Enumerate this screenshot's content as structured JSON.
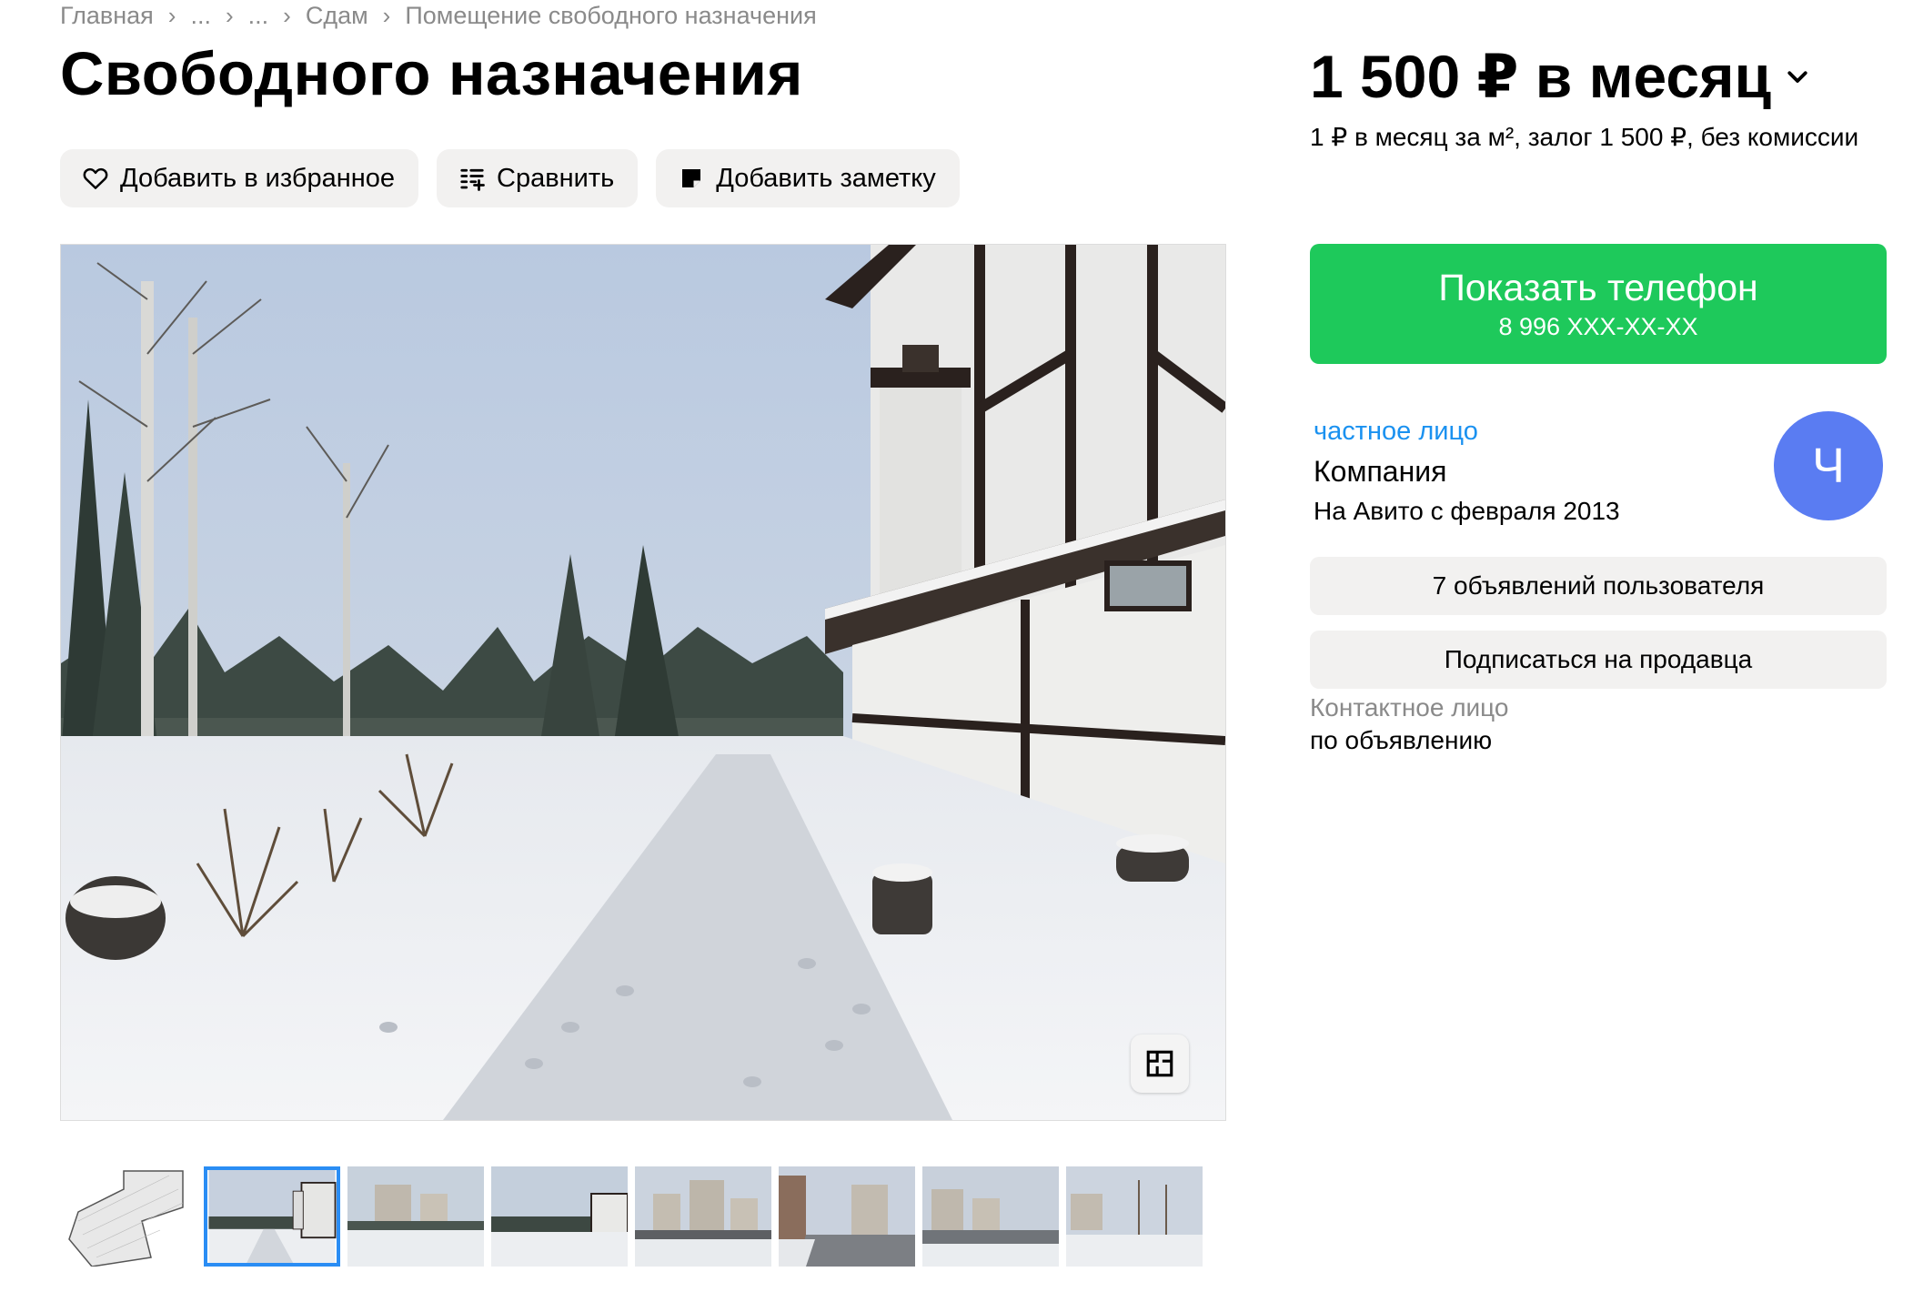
{
  "breadcrumb": {
    "items": [
      "Главная",
      "...",
      "...",
      "Сдам",
      "Помещение свободного назначения"
    ],
    "separator": "›"
  },
  "title": "Свободного назначения",
  "actions": {
    "favorite_label": "Добавить в избранное",
    "compare_label": "Сравнить",
    "note_label": "Добавить заметку"
  },
  "price": {
    "value": "1 500 ₽ в месяц",
    "details": "1 ₽ в месяц за м², залог 1 500 ₽, без комиссии"
  },
  "phone_button": {
    "label": "Показать телефон",
    "number": "8 996 XXX-XX-XX",
    "color": "#1ec95b"
  },
  "seller": {
    "type": "частное лицо",
    "name": "Компания",
    "since": "На Авито с февраля 2013",
    "avatar_letter": "Ч",
    "avatar_color": "#5a7cf2"
  },
  "seller_buttons": {
    "listings_label": "7 объявлений пользователя",
    "subscribe_label": "Подписаться на продавца"
  },
  "contact": {
    "label": "Контактное лицо",
    "value": "по объявлению"
  },
  "gallery": {
    "thumb_count": 8,
    "active_thumb": 1,
    "accent_color": "#2a8df4"
  }
}
